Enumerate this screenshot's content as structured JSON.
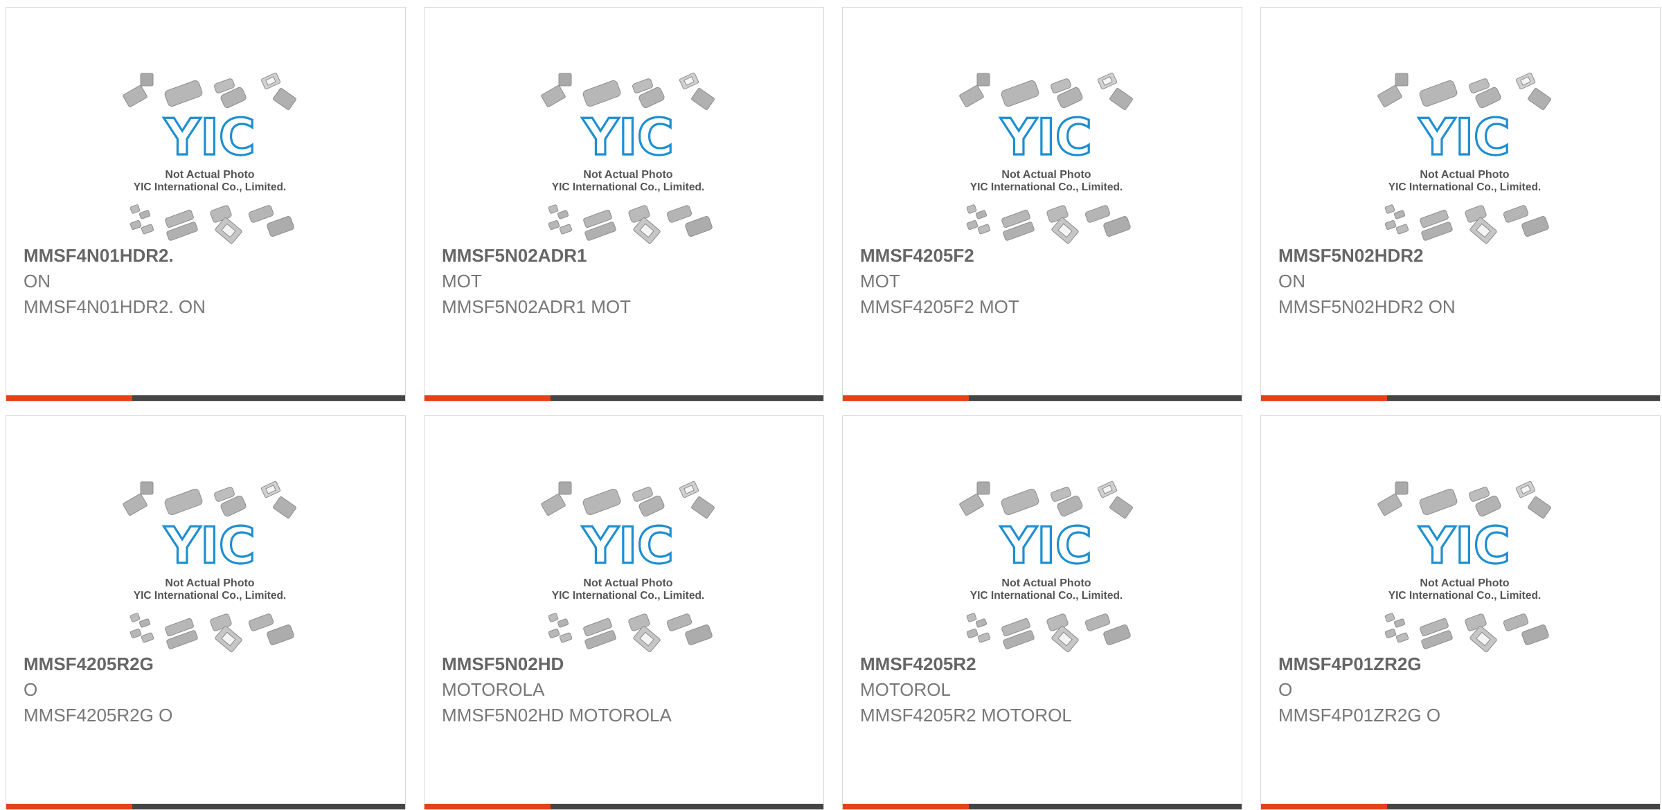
{
  "placeholder": {
    "line1": "Not Actual Photo",
    "line2": "YIC International Co., Limited.",
    "logo": "YIC"
  },
  "colors": {
    "accent": "#e8401a",
    "bar": "#454545",
    "logo": "#1e8fd0"
  },
  "products": [
    {
      "part": "MMSF4N01HDR2.",
      "mfr": "ON",
      "desc": "MMSF4N01HDR2. ON"
    },
    {
      "part": "MMSF5N02ADR1",
      "mfr": "MOT",
      "desc": "MMSF5N02ADR1 MOT"
    },
    {
      "part": "MMSF4205F2",
      "mfr": "MOT",
      "desc": "MMSF4205F2 MOT"
    },
    {
      "part": "MMSF5N02HDR2",
      "mfr": "ON",
      "desc": "MMSF5N02HDR2 ON"
    },
    {
      "part": "MMSF4205R2G",
      "mfr": "O",
      "desc": "MMSF4205R2G O"
    },
    {
      "part": "MMSF5N02HD",
      "mfr": "MOTOROLA",
      "desc": "MMSF5N02HD MOTOROLA"
    },
    {
      "part": "MMSF4205R2",
      "mfr": "MOTOROL",
      "desc": "MMSF4205R2 MOTOROL"
    },
    {
      "part": "MMSF4P01ZR2G",
      "mfr": "O",
      "desc": "MMSF4P01ZR2G O"
    }
  ]
}
